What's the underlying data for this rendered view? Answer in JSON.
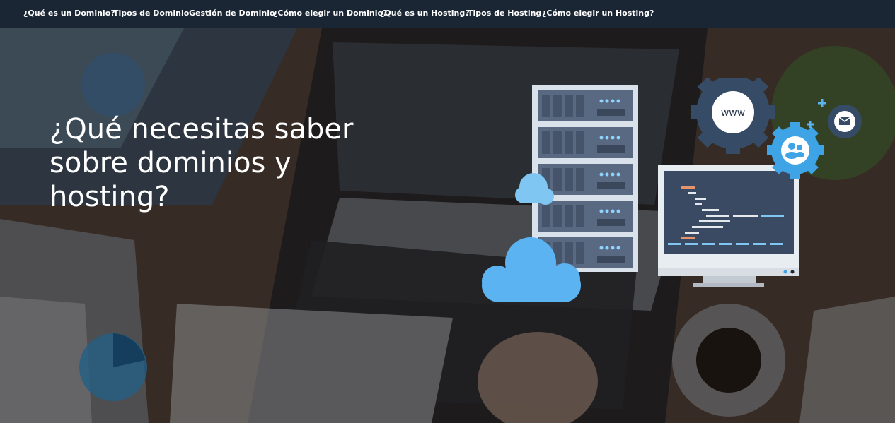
{
  "nav": {
    "items": [
      {
        "label": "¿Qué es un Dominio?"
      },
      {
        "label": "Tipos de Dominio"
      },
      {
        "label": "Gestión de Dominio"
      },
      {
        "label": "¿Cómo elegir un Dominio?"
      },
      {
        "label": "¿Qué es un Hosting?"
      },
      {
        "label": "Tipos de Hosting"
      },
      {
        "label": "¿Cómo elegir un Hosting?"
      }
    ]
  },
  "hero": {
    "title": "¿Qué necesitas saber sobre dominios y hosting?"
  },
  "illustration": {
    "www_label": "www"
  },
  "colors": {
    "nav_bg": "#1a2633",
    "cloud": "#5bb4f1",
    "server": "#5c6b85",
    "gear": "#364b66",
    "gear_accent": "#3ea4e6"
  }
}
